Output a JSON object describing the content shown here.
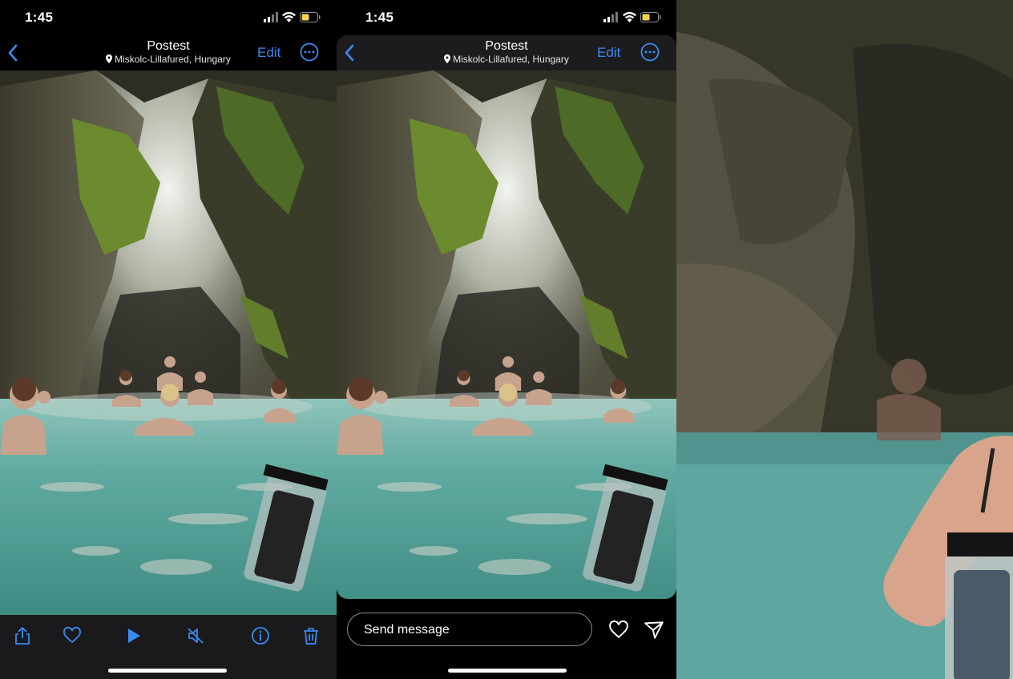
{
  "screen1": {
    "status": {
      "time": "1:45"
    },
    "nav": {
      "title": "Postest",
      "location": "Miskolc-Lillafured, Hungary",
      "edit_label": "Edit"
    },
    "toolbar": [
      "share-icon",
      "heart-icon",
      "play-icon",
      "mute-icon",
      "info-icon",
      "trash-icon"
    ]
  },
  "screen2": {
    "status": {
      "time": "1:45"
    },
    "nav": {
      "title": "Postest",
      "location": "Miskolc-Lillafured, Hungary",
      "edit_label": "Edit"
    },
    "compose": {
      "placeholder": "Send message"
    }
  },
  "colors": {
    "accent": "#3a8bf2",
    "toolbar_bg": "#1a1a1c",
    "water": "#5fa9a0"
  }
}
